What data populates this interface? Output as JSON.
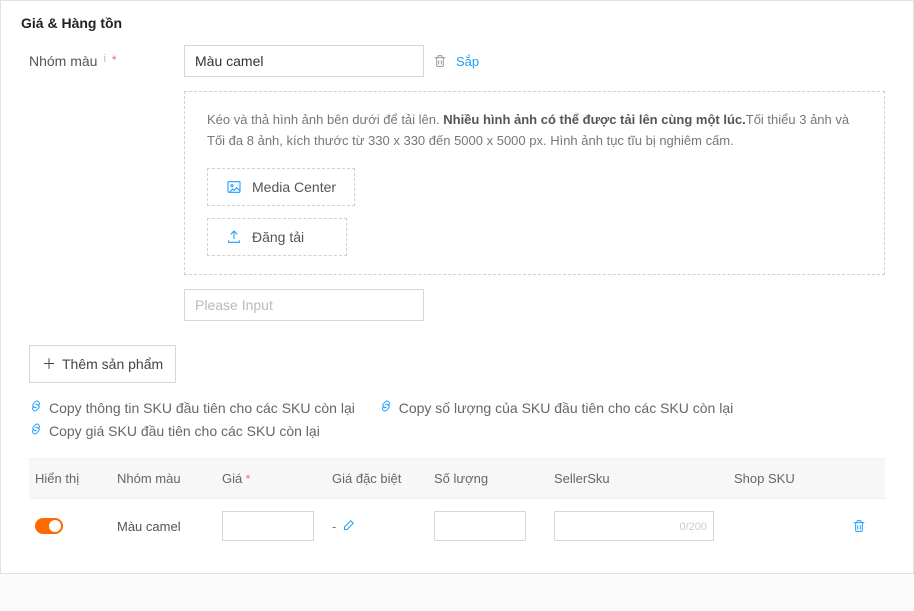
{
  "section": {
    "title": "Giá & Hàng tồn"
  },
  "variant_label": "Nhóm màu",
  "variant": {
    "value": "Màu camel",
    "sort_label": "Sắp",
    "upload_hint_prefix": "Kéo và thả hình ảnh bên dưới để tải lên. ",
    "upload_hint_bold": "Nhiều hình ảnh có thể được tải lên cùng một lúc.",
    "upload_hint_suffix": "Tối thiểu 3 ảnh và Tối đa 8 ảnh, kích thước từ 330 x 330 đến 5000 x 5000 px. Hình ảnh tục tĩu bị nghiêm cấm.",
    "media_center_label": "Media Center",
    "upload_label": "Đăng tải",
    "second_placeholder": "Please Input"
  },
  "add_product_label": "Thêm sản phẩm",
  "copy_links": {
    "copy_sku_info": "Copy thông tin SKU đầu tiên cho các SKU còn lại",
    "copy_qty": "Copy số lượng của SKU đầu tiên cho các SKU còn lại",
    "copy_price": "Copy giá SKU đầu tiên cho các SKU còn lại"
  },
  "table": {
    "headers": {
      "display": "Hiển thị",
      "color": "Nhóm màu",
      "price": "Giá",
      "special": "Giá đặc biệt",
      "qty": "Số lượng",
      "sellersku": "SellerSku",
      "shopsku": "Shop SKU"
    },
    "row": {
      "color": "Màu camel",
      "special_dash": "-",
      "sellersku_placeholder": "0/200"
    }
  }
}
